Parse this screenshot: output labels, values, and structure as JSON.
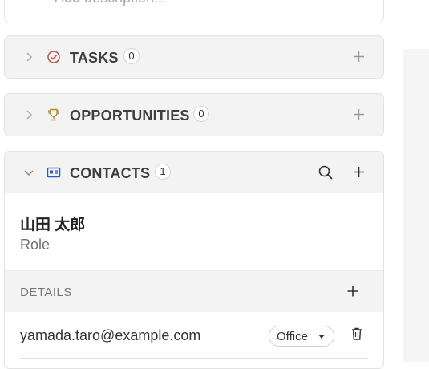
{
  "description": {
    "placeholder": "Add description..."
  },
  "sections": [
    {
      "id": "tasks",
      "title": "TASKS",
      "count": "0",
      "icon": "tasks-icon",
      "expanded": false
    },
    {
      "id": "opportunities",
      "title": "OPPORTUNITIES",
      "count": "0",
      "icon": "trophy-icon",
      "expanded": false
    },
    {
      "id": "contacts",
      "title": "CONTACTS",
      "count": "1",
      "icon": "contact-card-icon",
      "expanded": true
    }
  ],
  "contact": {
    "name": "山田 太郎",
    "role": "Role",
    "details_label": "DETAILS",
    "email": "yamada.taro@example.com",
    "email_type": "Office"
  },
  "colors": {
    "tasks_icon": "#c0504d",
    "opportunities_icon": "#b88a2a",
    "contacts_icon": "#2a5db0"
  }
}
